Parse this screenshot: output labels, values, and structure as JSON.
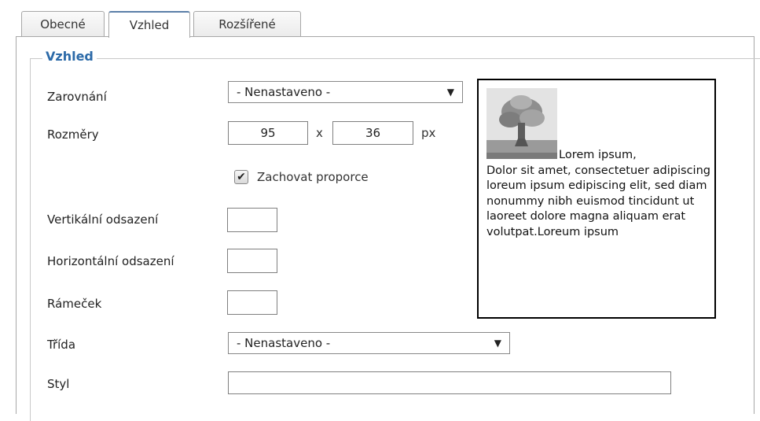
{
  "tabs": [
    {
      "label": "Obecné"
    },
    {
      "label": "Vzhled"
    },
    {
      "label": "Rozšířené"
    }
  ],
  "fieldset": {
    "legend": "Vzhled"
  },
  "form": {
    "alignment": {
      "label": "Zarovnání",
      "value": "- Nenastaveno -"
    },
    "dimensions": {
      "label": "Rozměry",
      "width": "95",
      "separator": "x",
      "height": "36",
      "unit": "px"
    },
    "keep_ratio": {
      "label": "Zachovat proporce",
      "checked": true
    },
    "vspace": {
      "label": "Vertikální odsazení",
      "value": ""
    },
    "hspace": {
      "label": "Horizontální odsazení",
      "value": ""
    },
    "border": {
      "label": "Rámeček",
      "value": ""
    },
    "class": {
      "label": "Třída",
      "value": "- Nenastaveno -"
    },
    "style": {
      "label": "Styl",
      "value": ""
    }
  },
  "preview": {
    "first_line": "Lorem ipsum,",
    "rest": "Dolor sit amet, consectetuer adipiscing loreum ipsum edipiscing elit, sed diam nonummy nibh euismod tincidunt ut laoreet dolore magna aliquam erat volutpat.Loreum ipsum"
  },
  "icons": {
    "dropdown": "triangle-down-icon",
    "check": "checkmark-icon"
  }
}
